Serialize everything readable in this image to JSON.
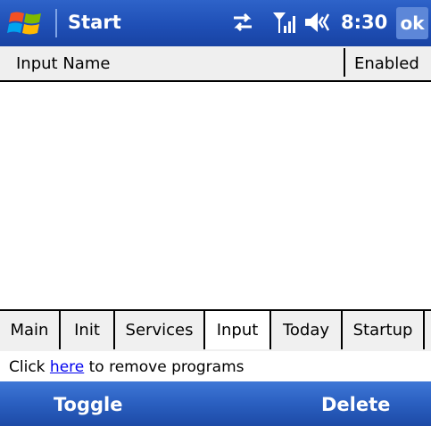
{
  "titlebar": {
    "title": "Start",
    "time": "8:30",
    "ok_label": "ok",
    "icons": [
      "windows-flag-icon",
      "connectivity-icon",
      "signal-icon",
      "volume-icon"
    ]
  },
  "list": {
    "columns": [
      "Input Name",
      "Enabled"
    ],
    "rows": []
  },
  "tabs": {
    "items": [
      "Main",
      "Init",
      "Services",
      "Input",
      "Today",
      "Startup"
    ],
    "selected": "Input"
  },
  "footer": {
    "text_before": "Click ",
    "link_text": "here",
    "text_after": " to remove programs"
  },
  "softkeys": {
    "left": "Toggle",
    "right": "Delete"
  },
  "colors": {
    "titlebar": "#1f4fb6",
    "softkey_bar": "#2a5fc0",
    "link": "#0000ee"
  }
}
